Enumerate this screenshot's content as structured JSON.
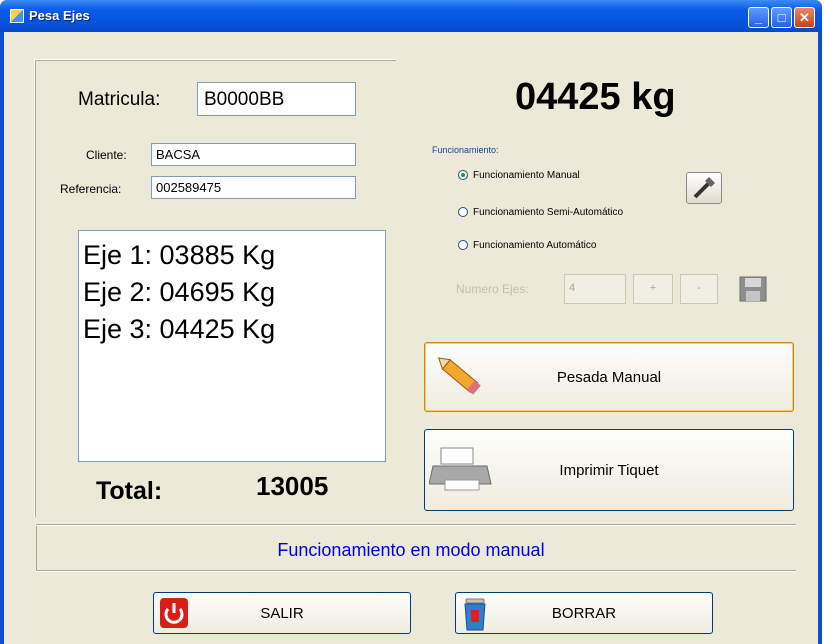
{
  "window": {
    "title": "Pesa Ejes"
  },
  "form": {
    "matricula_label": "Matricula:",
    "matricula_value": "B0000BB",
    "cliente_label": "Cliente:",
    "cliente_value": "BACSA",
    "referencia_label": "Referencia:",
    "referencia_value": "002589475"
  },
  "axles": [
    "Eje 1: 03885 Kg",
    "Eje 2: 04695 Kg",
    "Eje 3: 04425 Kg"
  ],
  "total": {
    "label": "Total:",
    "value": "13005"
  },
  "weight_display": "04425 kg",
  "mode": {
    "group_label": "Funcionamiento:",
    "options": [
      "Funcionamiento Manual",
      "Funcionamiento Semi-Automático",
      "Funcionamiento Automático"
    ],
    "selected": "Funcionamiento Manual",
    "axles_label": "Numero Ejes:",
    "axles_value": "4",
    "plus": "+",
    "minus": "-"
  },
  "buttons": {
    "manual_weigh": "Pesada Manual",
    "print_ticket": "Imprimir Tiquet",
    "exit": "SALIR",
    "clear": "BORRAR"
  },
  "status": "Funcionamiento en modo manual"
}
